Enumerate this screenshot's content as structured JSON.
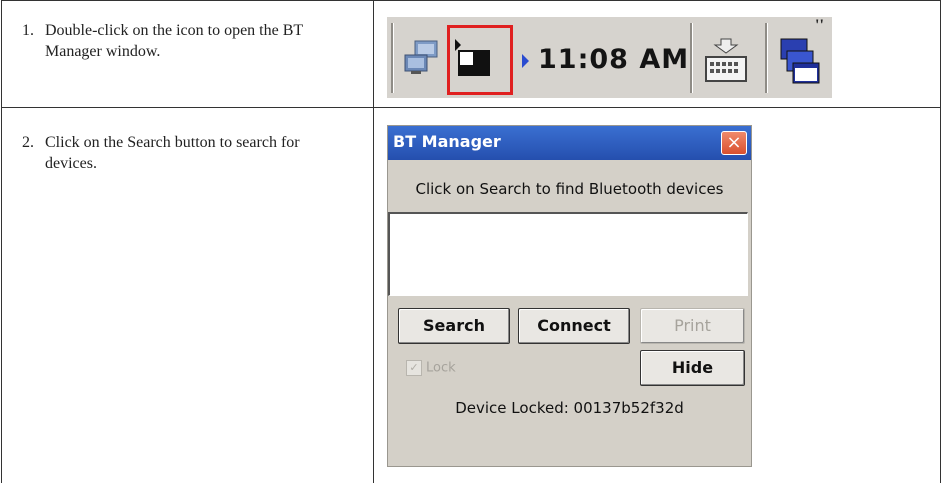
{
  "steps": [
    {
      "number": "1.",
      "text": "Double-click on the icon to open the BT Manager window."
    },
    {
      "number": "2.",
      "text": "Click on the Search button to search for devices."
    }
  ],
  "taskbar": {
    "clock": "11:08 AM",
    "icons": [
      "network-icon",
      "bluetooth-manager-icon",
      "arrow-icon",
      "keyboard-icon",
      "window-switcher-icon"
    ],
    "highlight_color": "#e02020"
  },
  "dialog": {
    "title": "BT Manager",
    "close_label": "×",
    "instruction": "Click on Search to find Bluetooth devices",
    "buttons": {
      "search": "Search",
      "connect": "Connect",
      "print": "Print",
      "hide": "Hide"
    },
    "lock_label": "Lock",
    "device_locked": "Device Locked: 00137b52f32d"
  }
}
